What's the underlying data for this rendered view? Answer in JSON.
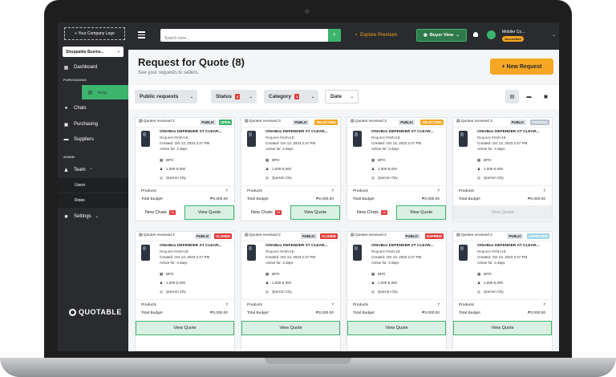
{
  "sidebar": {
    "company_logo": "+ Your Company Logo",
    "business_select": "Shoppable Busine...",
    "dashboard": "Dashboard",
    "section_purchasing": "PURCHASING",
    "rfqs": "RFQs",
    "chats": "Chats",
    "purchasing": "Purchasing",
    "suppliers": "Suppliers",
    "section_admin": "ADMIN",
    "team": "Team",
    "users": "Users",
    "roles": "Roles",
    "settings": "Settings",
    "brand": "QUOTABLE"
  },
  "topbar": {
    "search_placeholder": "Search here...",
    "explore": "Explore Premium",
    "buyer_view": "Buyer View",
    "account_name": "Mobiler Co...",
    "account_badge": "Accredited"
  },
  "page": {
    "title": "Request for Quote (8)",
    "subtitle": "See your requests to sellers.",
    "new_request": "+ New Request"
  },
  "filters": {
    "public_requests": "Public requests",
    "status": "Status",
    "status_count": "5",
    "category": "Category",
    "category_count": "3",
    "date": "Date"
  },
  "cards": [
    {
      "quotes": "Quotes received 2",
      "visibility": "PUBLIC",
      "status": "OPEN",
      "product": "OtterBox DEFENDER XT CLEAR...",
      "request": "Request #KMV1B",
      "created": "Created: Oct 13, 2023 2:47 PM",
      "active": "Active for: 3 days",
      "type": "BPO",
      "size": "1,000-5,000",
      "location": "Quezon City",
      "products_label": "Products",
      "products": "7",
      "budget_label": "Total Budget",
      "budget": "₱2,000.00",
      "chats": "New Chats",
      "chats_count": "15",
      "view": "View Quote"
    },
    {
      "quotes": "Quotes received 3",
      "visibility": "PUBLIC",
      "status": "SELECTING",
      "product": "OtterBox DEFENDER XT CLEAR...",
      "request": "Request #KMV1B",
      "created": "Created: Oct 13, 2023 2:47 PM",
      "active": "Active for: 3 days",
      "type": "BPO",
      "size": "1,000-5,000",
      "location": "Quezon City",
      "products_label": "Products",
      "products": "7",
      "budget_label": "Total Budget",
      "budget": "₱2,000.00",
      "chats": "New Chats",
      "chats_count": "15",
      "view": "View Quote"
    },
    {
      "quotes": "Quotes received 3",
      "visibility": "PUBLIC",
      "status": "SELECTING",
      "product": "OtterBox DEFENDER XT CLEAR...",
      "request": "Request #KMV1B",
      "created": "Created: Oct 13, 2023 2:47 PM",
      "active": "Active for: 3 days",
      "type": "BPO",
      "size": "1,000-5,000",
      "location": "Quezon City",
      "products_label": "Products",
      "products": "7",
      "budget_label": "Total Budget",
      "budget": "₱2,000.00",
      "chats": "New Chats",
      "chats_count": "15",
      "view": "View Quote"
    },
    {
      "quotes": "Quotes received 3",
      "visibility": "PUBLIC",
      "status": "PENDING",
      "product": "OtterBox DEFENDER XT CLEAR...",
      "request": "Request #KMV1B",
      "created": "Created: Oct 13, 2023 2:47 PM",
      "active": "Active for: 3 days",
      "type": "BPO",
      "size": "1,000-5,000",
      "location": "Quezon City",
      "products_label": "Products",
      "products": "7",
      "budget_label": "Total Budget",
      "budget": "₱2,000.00",
      "view": "View Quote"
    },
    {
      "quotes": "Quotes received 2",
      "visibility": "PUBLIC",
      "status": "CLOSED",
      "product": "OtterBox DEFENDER XT CLEAR...",
      "request": "Request #KMV1B",
      "created": "Created: Oct 13, 2023 2:47 PM",
      "active": "Active for: 3 days",
      "type": "BPO",
      "size": "1,000-5,000",
      "location": "Quezon City",
      "products_label": "Products",
      "products": "7",
      "budget_label": "Total Budget",
      "budget": "₱2,000.00",
      "view": "View Quote"
    },
    {
      "quotes": "Quotes received 2",
      "visibility": "PUBLIC",
      "status": "CLOSED",
      "product": "OtterBox DEFENDER XT CLEAR...",
      "request": "Request #KMV1B",
      "created": "Created: Oct 13, 2023 2:47 PM",
      "active": "Active for: 3 days",
      "type": "BPO",
      "size": "1,000-5,000",
      "location": "Quezon City",
      "products_label": "Products",
      "products": "7",
      "budget_label": "Total Budget",
      "budget": "₱2,000.00",
      "view": "View Quote"
    },
    {
      "quotes": "Quotes received 2",
      "visibility": "PUBLIC",
      "status": "EXPIRED",
      "product": "OtterBox DEFENDER XT CLEAR...",
      "request": "Request #KMV1B",
      "created": "Created: Oct 13, 2023 2:47 PM",
      "active": "Active for: 3 days",
      "type": "BPO",
      "size": "1,000-5,000",
      "location": "Quezon City",
      "products_label": "Products",
      "products": "7",
      "budget_label": "Total Budget",
      "budget": "₱2,000.00",
      "view": "View Quote"
    },
    {
      "quotes": "Quotes received 2",
      "visibility": "PUBLIC",
      "status": "APPROVED",
      "product": "OtterBox DEFENDER XT CLEAR...",
      "request": "Request #KMV1B",
      "created": "Created: Oct 13, 2023 2:47 PM",
      "active": "Active for: 3 days",
      "type": "BPO",
      "size": "1,000-5,000",
      "location": "Quezon City",
      "products_label": "Products",
      "products": "7",
      "budget_label": "Total Budget",
      "budget": "₱2,000.00",
      "view": "View Quote"
    }
  ]
}
